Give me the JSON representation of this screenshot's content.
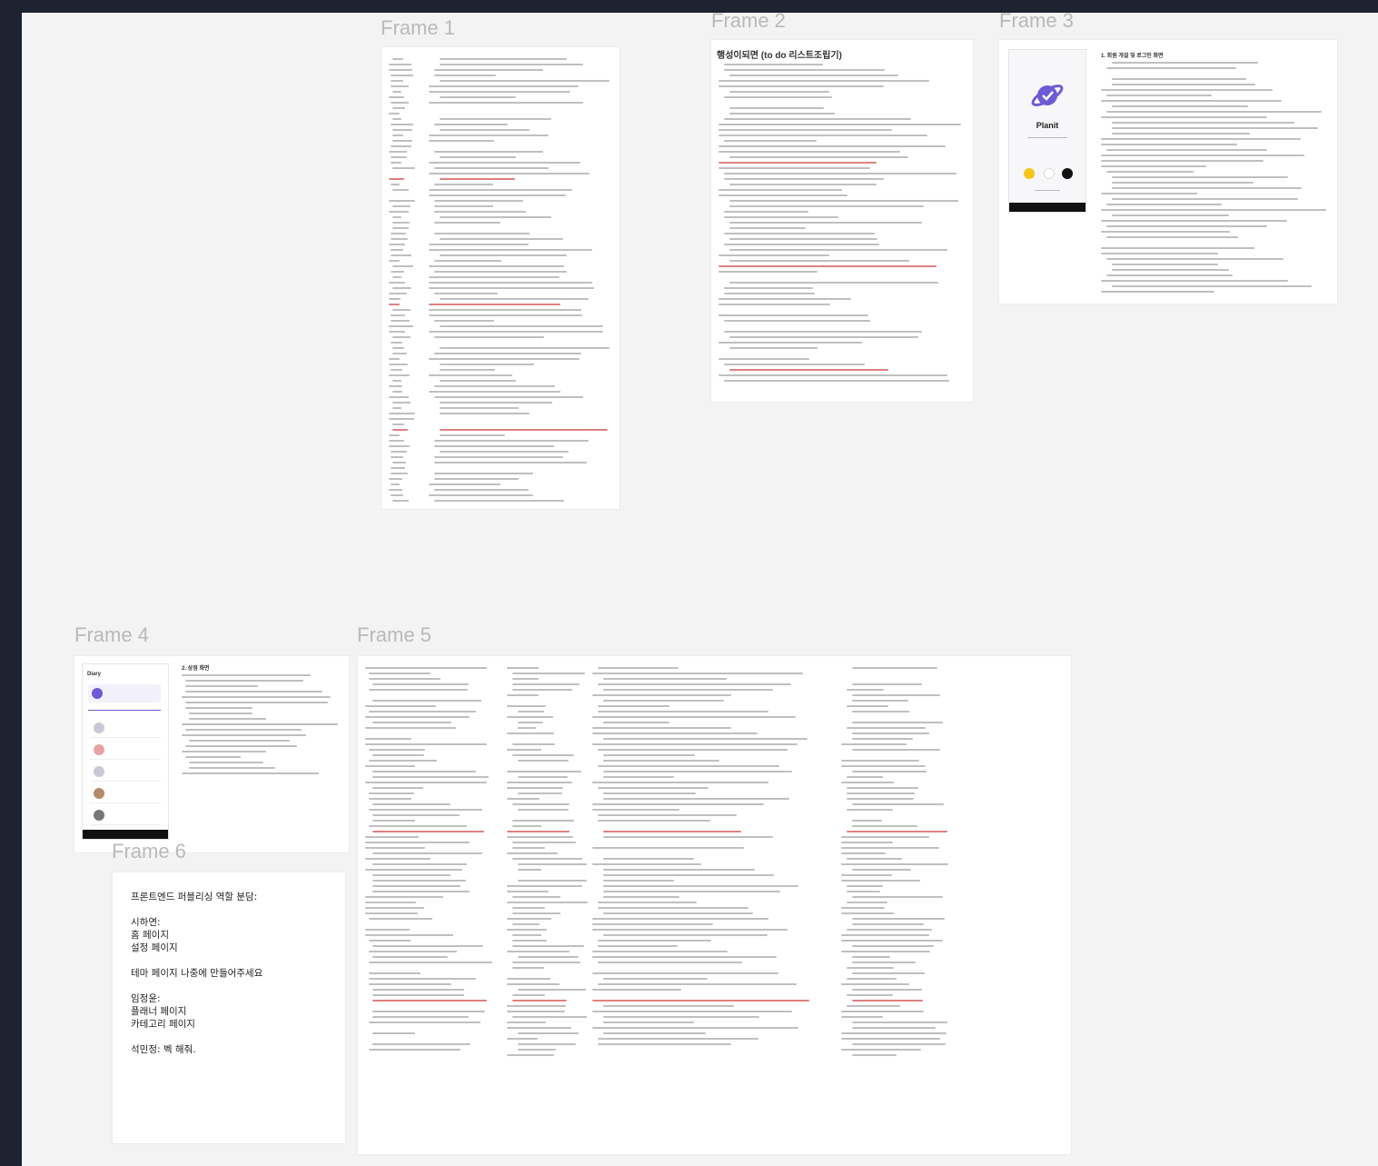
{
  "frames": {
    "f1": {
      "title": "Frame 1"
    },
    "f2": {
      "title": "Frame 2",
      "doc_heading": "행성이되면 (to do 리스트조립기)"
    },
    "f3": {
      "title": "Frame 3",
      "app_name": "Planit",
      "section_heading": "1. 회원 개설 및 로그인 화면"
    },
    "f4": {
      "title": "Frame 4",
      "app_header": "Diary",
      "section_heading": "2. 상점 화면"
    },
    "f5": {
      "title": "Frame 5"
    },
    "f6": {
      "title": "Frame 6",
      "note": "프론트엔드 퍼블리싱 역할 분담:\n\n시하연:\n홈 페이지\n설정 페이지\n\n테마 페이지 나중에 만들어주세요\n\n임정윤:\n플래너 페이지\n카테고리 페이지\n\n석민정: 벡 해줘."
    }
  },
  "colors": {
    "topbar": "#1e2332",
    "canvas": "#f3f3f3",
    "frame_bg": "#ffffff",
    "accent_purple": "#6b5bd6",
    "accent_red": "#d24a4a",
    "accent_yellow": "#f5c518"
  }
}
